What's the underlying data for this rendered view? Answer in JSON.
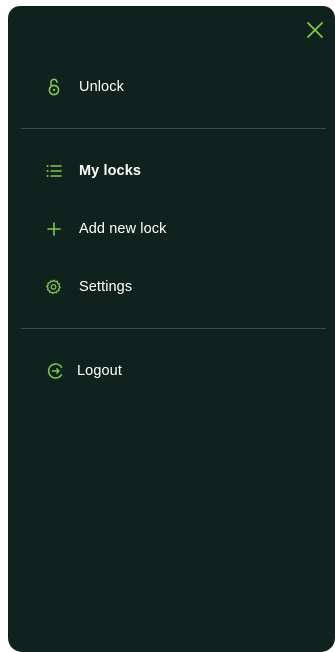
{
  "menu": {
    "close_icon": "close-icon",
    "accent_color": "#7ec850",
    "background_color": "#10221d",
    "unlock": {
      "label": "Unlock",
      "icon": "padlock-open-icon"
    },
    "my_locks": {
      "label": "My locks",
      "icon": "list-icon",
      "active": true
    },
    "add_new_lock": {
      "label": "Add new lock",
      "icon": "plus-icon"
    },
    "settings": {
      "label": "Settings",
      "icon": "gear-icon"
    },
    "logout": {
      "label": "Logout",
      "icon": "logout-icon"
    }
  }
}
